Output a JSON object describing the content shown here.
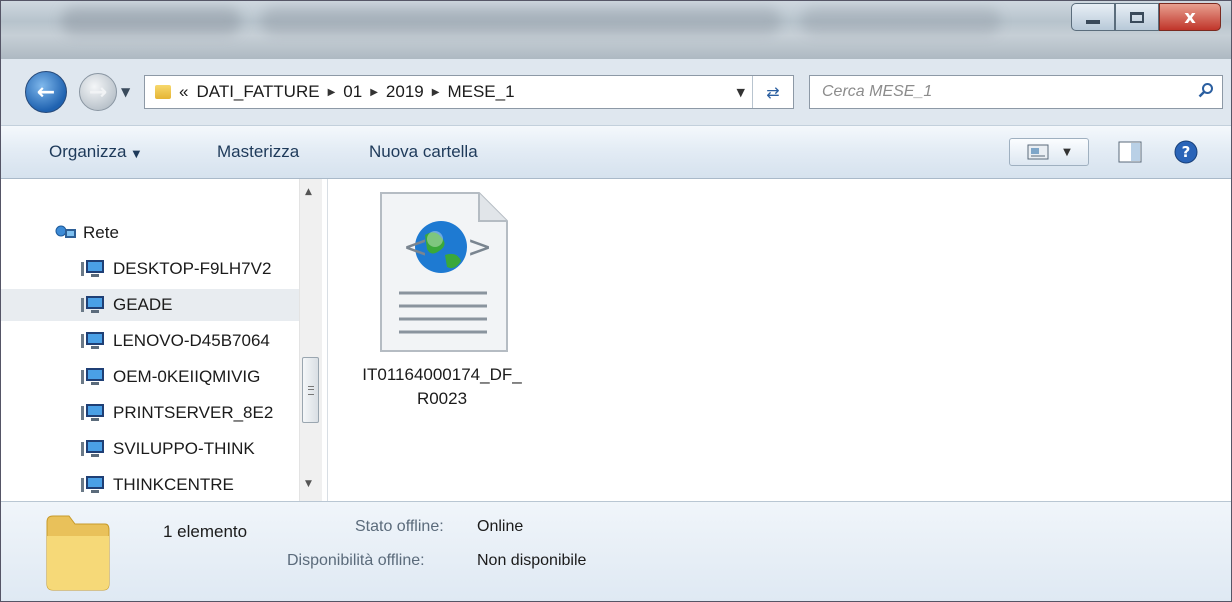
{
  "window": {
    "controls": {
      "minimize": "minimize",
      "maximize": "maximize",
      "close": "x"
    }
  },
  "address_bar": {
    "overflow": "«",
    "crumbs": [
      "DATI_FATTURE",
      "01",
      "2019",
      "MESE_1"
    ],
    "search_placeholder": "Cerca MESE_1"
  },
  "toolbar": {
    "organize": "Organizza",
    "burn": "Masterizza",
    "new_folder": "Nuova cartella"
  },
  "nav_pane": {
    "network_label": "Rete",
    "computers": [
      "DESKTOP-F9LH7V2",
      "GEADE",
      "LENOVO-D45B7064",
      "OEM-0KEIIQMIVIG",
      "PRINTSERVER_8E2",
      "SVILUPPO-THINK",
      "THINKCENTRE"
    ],
    "selected": "GEADE"
  },
  "files": [
    {
      "name": "IT01164000174_DF_R0023",
      "icon": "xml-web-document-icon"
    }
  ],
  "status": {
    "count": "1 elemento",
    "offline_status_label": "Stato offline:",
    "offline_status_value": "Online",
    "offline_availability_label": "Disponibilità offline:",
    "offline_availability_value": "Non disponibile"
  }
}
